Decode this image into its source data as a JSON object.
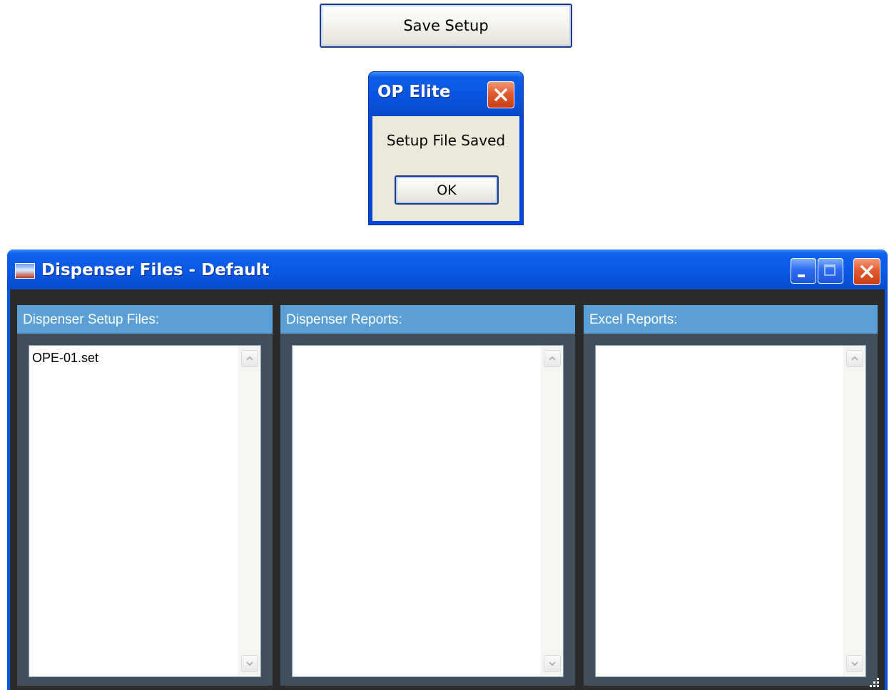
{
  "save_button": {
    "label": "Save Setup"
  },
  "message_box": {
    "title": "OP Elite",
    "message": "Setup File Saved",
    "ok_label": "OK"
  },
  "dispenser_window": {
    "title": "Dispenser Files - Default",
    "icon": "op-elite-app-icon",
    "panels": [
      {
        "header": "Dispenser Setup Files:",
        "items": [
          "OPE-01.set"
        ]
      },
      {
        "header": "Dispenser Reports:",
        "items": []
      },
      {
        "header": "Excel Reports:",
        "items": []
      }
    ]
  },
  "colors": {
    "xp_title_blue": "#0a58e4",
    "xp_close_red": "#e25b30",
    "panel_header_blue": "#5aa0d6",
    "panel_bg": "#3f4f5c",
    "client_bg": "#2b2b2b",
    "dialog_bg": "#ece9d8"
  }
}
